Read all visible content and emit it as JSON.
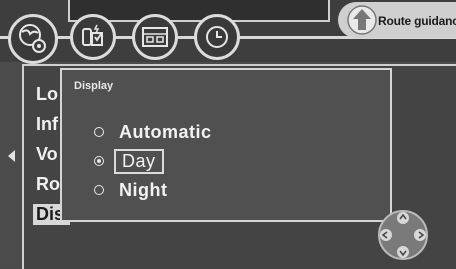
{
  "header": {
    "route_button_label": "Route guidance"
  },
  "menu": {
    "items": [
      {
        "label": "Lo"
      },
      {
        "label": "Inf"
      },
      {
        "label": "Vo"
      },
      {
        "label": "Ro"
      },
      {
        "label": "Dis"
      }
    ]
  },
  "popup": {
    "title": "Display",
    "options": [
      {
        "label": "Automatic",
        "selected": false,
        "focused": false
      },
      {
        "label": "Day",
        "selected": true,
        "focused": true
      },
      {
        "label": "Night",
        "selected": false,
        "focused": false
      }
    ]
  },
  "icons": {
    "settings": "globe-gear-icon",
    "phone": "phone-icon",
    "media": "screen-icon",
    "clock": "clock-icon",
    "route": "route-arrow-icon",
    "back": "left-arrow-icon",
    "joystick": "joystick-icon"
  }
}
